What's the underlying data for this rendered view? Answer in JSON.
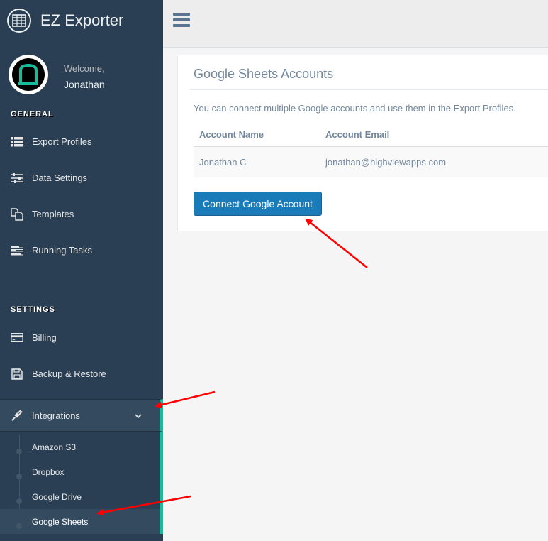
{
  "app": {
    "title": "EZ Exporter"
  },
  "profile": {
    "welcome": "Welcome,",
    "name": "Jonathan"
  },
  "sidebar": {
    "general_title": "GENERAL",
    "general_items": [
      {
        "label": "Export Profiles",
        "icon": "list-icon"
      },
      {
        "label": "Data Settings",
        "icon": "sliders-icon"
      },
      {
        "label": "Templates",
        "icon": "copy-icon"
      },
      {
        "label": "Running Tasks",
        "icon": "tasks-icon"
      }
    ],
    "settings_title": "SETTINGS",
    "settings_items": [
      {
        "label": "Billing",
        "icon": "credit-card-icon"
      },
      {
        "label": "Backup & Restore",
        "icon": "save-icon"
      }
    ],
    "integrations": {
      "label": "Integrations",
      "icon": "plug-icon",
      "expanded": true,
      "sub_items": [
        "Amazon S3",
        "Dropbox",
        "Google Drive",
        "Google Sheets"
      ],
      "selected": "Google Sheets"
    },
    "accent_color": "#1abb9c",
    "background_color": "#2a3f54"
  },
  "main": {
    "panel_title": "Google Sheets Accounts",
    "description": "You can connect multiple Google accounts and use them in the Export Profiles.",
    "table": {
      "headers": [
        "Account Name",
        "Account Email"
      ],
      "rows": [
        [
          "Jonathan C",
          "jonathan@highviewapps.com"
        ]
      ]
    },
    "connect_button": "Connect Google Account",
    "button_color": "#1a7bb9"
  },
  "annotations": {
    "arrow_color": "#ff0000"
  }
}
